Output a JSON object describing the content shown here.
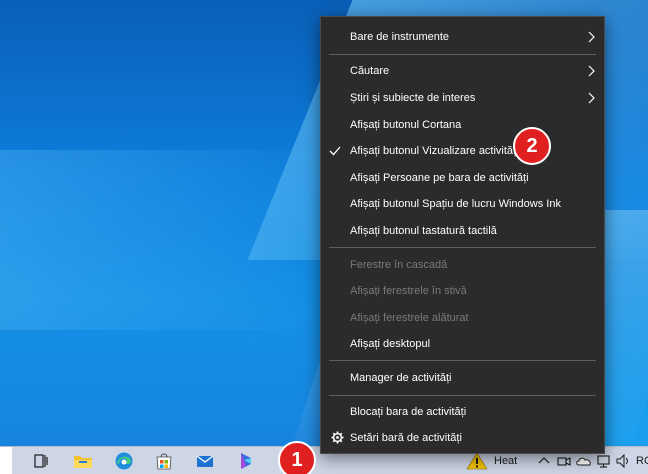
{
  "menu": {
    "toolbars": "Bare de instrumente",
    "search": "Căutare",
    "news": "Știri și subiecte de interes",
    "cortana": "Afișați butonul Cortana",
    "task_view": "Afișați butonul Vizualizare activități",
    "people": "Afișați Persoane pe bara de activități",
    "ink_workspace": "Afișați butonul Spațiu de lucru Windows Ink",
    "touch_keyboard": "Afișați butonul tastatură tactilă",
    "cascade": "Ferestre în cascadă",
    "stacked": "Afișați ferestrele în stivă",
    "side_by_side": "Afișați ferestrele alăturat",
    "show_desktop": "Afișați desktopul",
    "task_manager": "Manager de activități",
    "lock_taskbar": "Blocați bara de activități",
    "taskbar_settings": "Setări bară de activități"
  },
  "callouts": {
    "one": "1",
    "two": "2"
  },
  "taskbar": {
    "icons": [
      "task-view-icon",
      "file-explorer-icon",
      "edge-icon",
      "microsoft-store-icon",
      "mail-icon",
      "app-icon"
    ],
    "weather_label": "Heat",
    "language": "RO"
  },
  "colors": {
    "menu_bg": "#2b2b2b",
    "badge": "#e02020",
    "taskbar": "#ced6e6"
  }
}
